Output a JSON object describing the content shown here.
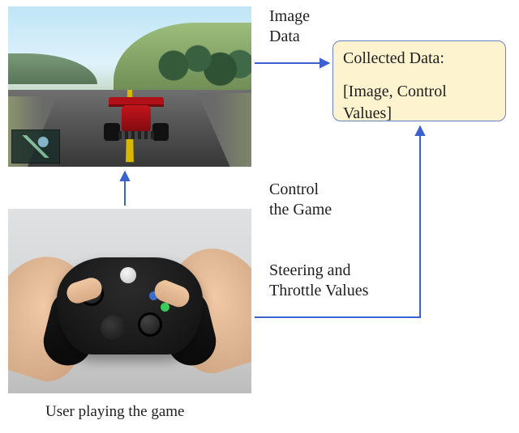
{
  "labels": {
    "image_data": "Image\nData",
    "control_the_game": "Control\nthe Game",
    "steering_throttle": "Steering and\nThrottle Values",
    "caption": "User playing the game"
  },
  "databox": {
    "title": "Collected Data:",
    "content": "[Image, Control Values]"
  },
  "arrows": {
    "color": "#3b61d1",
    "stroke_width": 2
  }
}
